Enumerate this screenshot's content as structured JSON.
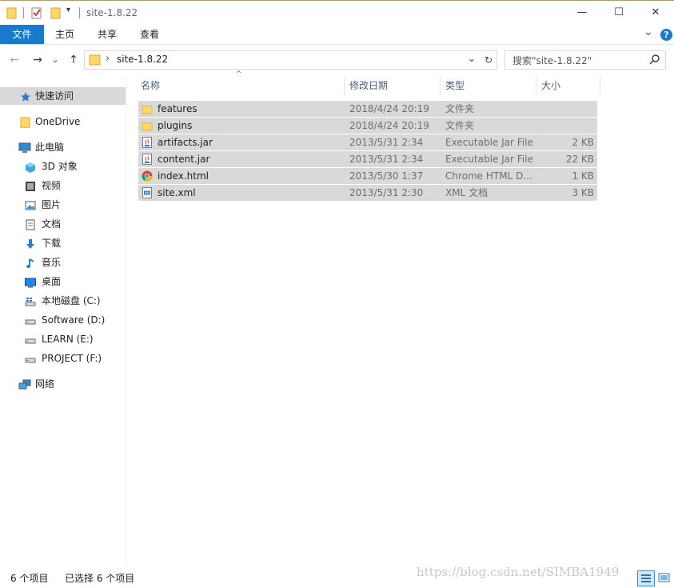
{
  "window": {
    "title": "site-1.8.22",
    "minimize_glyph": "—",
    "maximize_glyph": "☐",
    "close_glyph": "✕"
  },
  "ribbon": {
    "tabs": [
      "文件",
      "主页",
      "共享",
      "查看"
    ],
    "collapse_glyph": "⌄",
    "help_glyph": "?"
  },
  "address": {
    "back_glyph": "←",
    "forward_glyph": "→",
    "recent_glyph": "⌄",
    "up_glyph": "↑",
    "separator": "›",
    "path": "site-1.8.22",
    "dropdown_glyph": "⌄",
    "refresh_glyph": "↻",
    "search_placeholder": "搜索\"site-1.8.22\"",
    "search_icon": "search-icon"
  },
  "navigation": {
    "quick_access": "快速访问",
    "onedrive": "OneDrive",
    "this_pc": "此电脑",
    "items": [
      {
        "label": "3D 对象",
        "icon": "3d-objects-icon"
      },
      {
        "label": "视频",
        "icon": "video-icon"
      },
      {
        "label": "图片",
        "icon": "pictures-icon"
      },
      {
        "label": "文档",
        "icon": "documents-icon"
      },
      {
        "label": "下载",
        "icon": "downloads-icon"
      },
      {
        "label": "音乐",
        "icon": "music-icon"
      },
      {
        "label": "桌面",
        "icon": "desktop-icon"
      },
      {
        "label": "本地磁盘 (C:)",
        "icon": "system-drive-icon"
      },
      {
        "label": "Software (D:)",
        "icon": "drive-icon"
      },
      {
        "label": "LEARN (E:)",
        "icon": "drive-icon"
      },
      {
        "label": "PROJECT (F:)",
        "icon": "drive-icon"
      }
    ],
    "network": "网络"
  },
  "columns": {
    "name": "名称",
    "date": "修改日期",
    "type": "类型",
    "size": "大小",
    "sort_glyph": "^"
  },
  "files": [
    {
      "name": "features",
      "date": "2018/4/24 20:19",
      "type": "文件夹",
      "size": "",
      "icon": "folder-icon"
    },
    {
      "name": "plugins",
      "date": "2018/4/24 20:19",
      "type": "文件夹",
      "size": "",
      "icon": "folder-icon"
    },
    {
      "name": "artifacts.jar",
      "date": "2013/5/31 2:34",
      "type": "Executable Jar File",
      "size": "2 KB",
      "icon": "jar-file-icon"
    },
    {
      "name": "content.jar",
      "date": "2013/5/31 2:34",
      "type": "Executable Jar File",
      "size": "22 KB",
      "icon": "jar-file-icon"
    },
    {
      "name": "index.html",
      "date": "2013/5/30 1:37",
      "type": "Chrome HTML D...",
      "size": "1 KB",
      "icon": "chrome-icon"
    },
    {
      "name": "site.xml",
      "date": "2013/5/31 2:30",
      "type": "XML 文档",
      "size": "3 KB",
      "icon": "xml-file-icon"
    }
  ],
  "status": {
    "item_count": "6 个项目",
    "selected": "已选择 6 个项目"
  },
  "watermark": "https://blog.csdn.net/SIMBA1949",
  "colors": {
    "accent": "#1979ca",
    "selection": "#d9d9d9",
    "folder": "#ffd868"
  }
}
